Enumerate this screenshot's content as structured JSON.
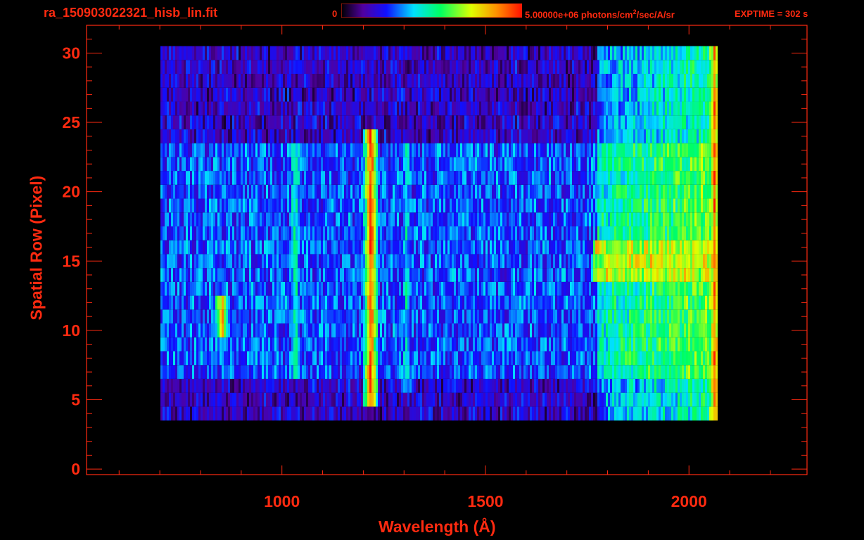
{
  "header": {
    "filename": "ra_150903022321_hisb_lin.fit",
    "colorbar_min": "0",
    "colorbar_max_value": "5.00000e+06 photons/cm",
    "colorbar_max_sup": "2",
    "colorbar_max_unit_rest": "/sec/A/sr",
    "exptime": "EXPTIME = 302 s"
  },
  "colors": {
    "text": "#ff2a10",
    "axis": "#ff2a10",
    "background": "#000000"
  },
  "chart_data": {
    "type": "heatmap",
    "title": "ra_150903022321_hisb_lin.fit",
    "xlabel": "Wavelength (Å)",
    "ylabel": "Spatial Row (Pixel)",
    "xlim": [
      520,
      2290
    ],
    "ylim": [
      -0.4,
      32
    ],
    "x_ticks": [
      1000,
      1500,
      2000
    ],
    "y_ticks": [
      0,
      5,
      10,
      15,
      20,
      25,
      30
    ],
    "colorbar": {
      "min": 0,
      "max": 5000000,
      "unit": "photons/cm2/sec/A/sr",
      "colormap": "rainbow"
    },
    "features": [
      {
        "name": "bright vertical line",
        "x": 1216,
        "rows": [
          5,
          24
        ],
        "level": 0.95
      },
      {
        "name": "vertical line",
        "x": 1030,
        "rows": [
          7,
          23
        ],
        "level": 0.5
      },
      {
        "name": "vertical line",
        "x": 1304,
        "rows": [
          6,
          23
        ],
        "level": 0.45
      },
      {
        "name": "bright compact source",
        "x": 850,
        "rows": [
          10,
          12
        ],
        "level": 0.85
      },
      {
        "name": "horizontal band",
        "x_range": [
          1760,
          2060
        ],
        "rows": [
          14,
          16
        ],
        "level": 0.75
      },
      {
        "name": "edge bright column",
        "x": 2060,
        "rows": [
          0,
          30
        ],
        "level": 0.9
      }
    ]
  }
}
